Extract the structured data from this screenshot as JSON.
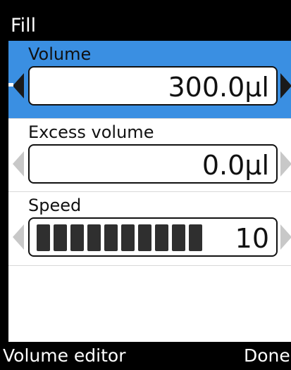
{
  "title": "Fill",
  "fields": [
    {
      "label": "Volume",
      "value": "300.0µl",
      "selected": true
    },
    {
      "label": "Excess volume",
      "value": "0.0µl",
      "selected": false
    },
    {
      "label": "Speed",
      "value": "10",
      "selected": false,
      "level": 10,
      "level_max": 10
    }
  ],
  "softkeys": {
    "left": "Volume editor",
    "right": "Done"
  },
  "colors": {
    "selection": "#3a8fe2",
    "bars": "#000000",
    "speed_segments": "#2f2f2f"
  },
  "icons": {
    "decrease": "left-arrow-icon",
    "increase": "right-arrow-icon"
  }
}
